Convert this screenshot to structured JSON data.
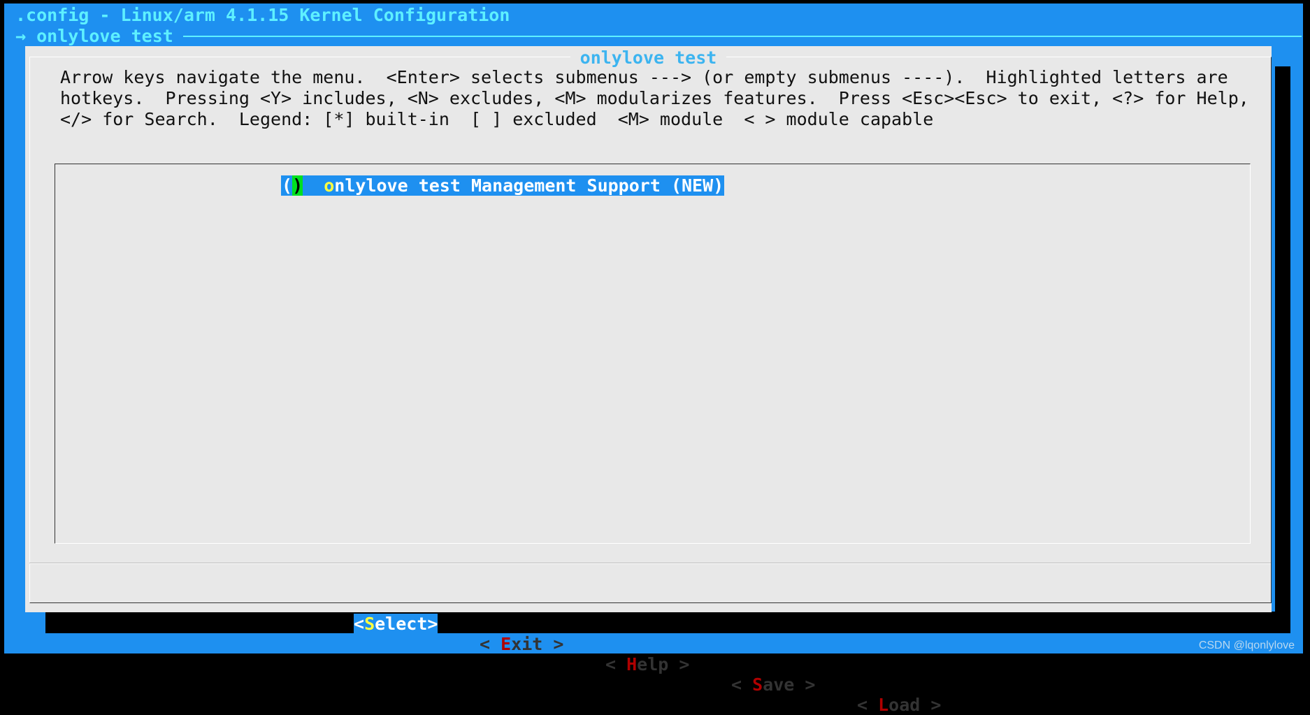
{
  "window": {
    "title": ".config - Linux/arm 4.1.15 Kernel Configuration",
    "breadcrumb_arrow": "→",
    "breadcrumb": "onlylove test"
  },
  "dialog": {
    "title": "onlylove test",
    "help_lines": [
      "Arrow keys navigate the menu.  <Enter> selects submenus ---> (or empty submenus ----).  Highlighted letters are",
      "hotkeys.  Pressing <Y> includes, <N> excludes, <M> modularizes features.  Press <Esc><Esc> to exit, <?> for Help,",
      "</> for Search.  Legend: [*] built-in  [ ] excluded  <M> module  < > module capable"
    ],
    "items": [
      {
        "open": "(",
        "close": ")",
        "hotkey": "o",
        "label": "nlylove test Management Support (NEW)",
        "selected": true
      }
    ]
  },
  "buttons": [
    {
      "pre": "<",
      "hotkey": "S",
      "rest": "elect",
      "post": ">",
      "selected": true
    },
    {
      "pre": "< ",
      "hotkey": "E",
      "rest": "xit",
      "post": " >"
    },
    {
      "pre": "< ",
      "hotkey": "H",
      "rest": "elp",
      "post": " >"
    },
    {
      "pre": "< ",
      "hotkey": "S",
      "rest": "ave",
      "post": " >"
    },
    {
      "pre": "< ",
      "hotkey": "L",
      "rest": "oad",
      "post": " >"
    }
  ],
  "watermark": "CSDN @lqonlylove",
  "colors": {
    "background": "#1e90f0",
    "dialog": "#e8e8e8",
    "title": "#5ef0ff",
    "hotkey": "#b00000",
    "highlight": "#ffff40"
  }
}
